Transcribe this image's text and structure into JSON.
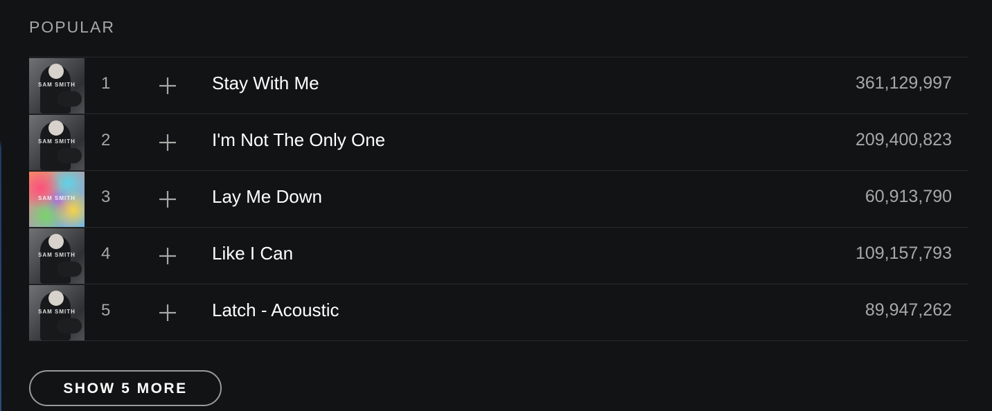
{
  "section": {
    "title": "POPULAR"
  },
  "tracks": [
    {
      "number": "1",
      "name": "Stay With Me",
      "plays": "361,129,997",
      "cover": "dark",
      "cover_text": "SAM SMITH"
    },
    {
      "number": "2",
      "name": "I'm Not The Only One",
      "plays": "209,400,823",
      "cover": "dark",
      "cover_text": "SAM SMITH"
    },
    {
      "number": "3",
      "name": "Lay Me Down",
      "plays": "60,913,790",
      "cover": "color",
      "cover_text": "SAM SMITH"
    },
    {
      "number": "4",
      "name": "Like I Can",
      "plays": "109,157,793",
      "cover": "dark",
      "cover_text": "SAM SMITH"
    },
    {
      "number": "5",
      "name": "Latch - Acoustic",
      "plays": "89,947,262",
      "cover": "dark",
      "cover_text": "SAM SMITH"
    }
  ],
  "icons": {
    "add": "plus-icon"
  },
  "colors": {
    "background": "#121314",
    "muted_text": "#a8a8a8",
    "divider": "#2a2b2d"
  },
  "show_more": {
    "label": "SHOW 5 MORE"
  }
}
